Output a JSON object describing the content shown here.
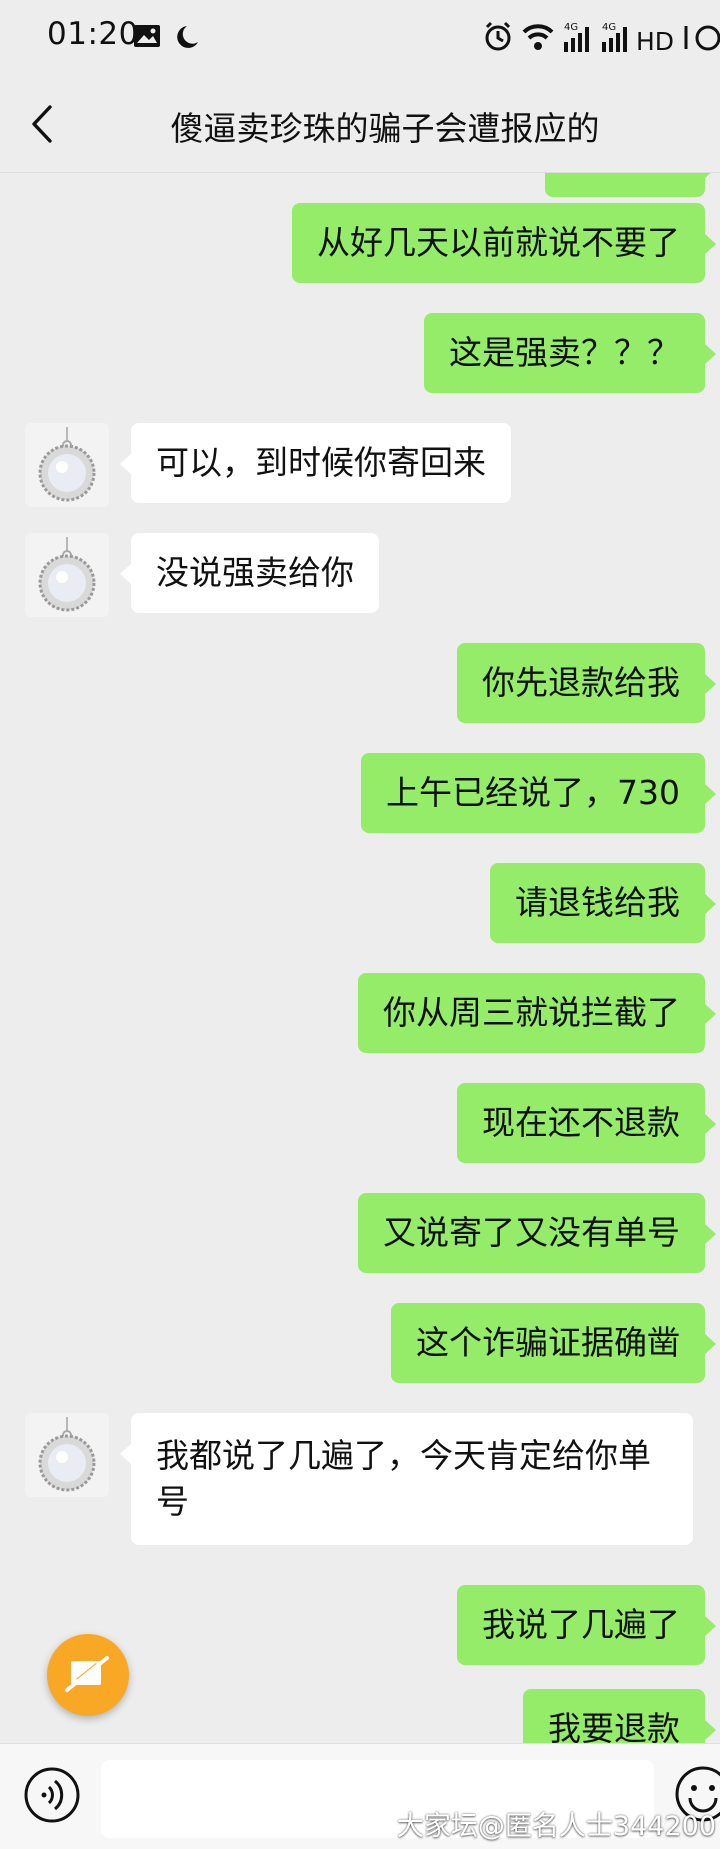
{
  "status_bar": {
    "time": "01:20",
    "network_label": "HD"
  },
  "header": {
    "title": "傻逼卖珍珠的骗子会遭报应的"
  },
  "messages": [
    {
      "direction": "out",
      "text": "从好几天以前就说不要了"
    },
    {
      "direction": "out",
      "text": "这是强卖？？？"
    },
    {
      "direction": "in",
      "text": "可以，到时候你寄回来"
    },
    {
      "direction": "in",
      "text": "没说强卖给你"
    },
    {
      "direction": "out",
      "text": "你先退款给我"
    },
    {
      "direction": "out",
      "text": "上午已经说了，730"
    },
    {
      "direction": "out",
      "text": "请退钱给我"
    },
    {
      "direction": "out",
      "text": "你从周三就说拦截了"
    },
    {
      "direction": "out",
      "text": "现在还不退款"
    },
    {
      "direction": "out",
      "text": "又说寄了又没有单号"
    },
    {
      "direction": "out",
      "text": "这个诈骗证据确凿"
    },
    {
      "direction": "in",
      "text": "我都说了几遍了，今天肯定给你单号"
    },
    {
      "direction": "out",
      "text": "我说了几遍了"
    },
    {
      "direction": "out",
      "text": "我要退款"
    }
  ],
  "input_bar": {
    "value": ""
  },
  "watermark": "大家坛@匿名人士344200",
  "colors": {
    "background": "#ededed",
    "outgoing_bubble": "#95ec69",
    "incoming_bubble": "#ffffff",
    "fab": "#f9a825"
  },
  "icons": {
    "back": "chevron-left-icon",
    "voice": "voice-icon",
    "emoji": "emoji-icon",
    "fab": "pen-off-icon",
    "avatar": "pearl-pendant-avatar"
  }
}
